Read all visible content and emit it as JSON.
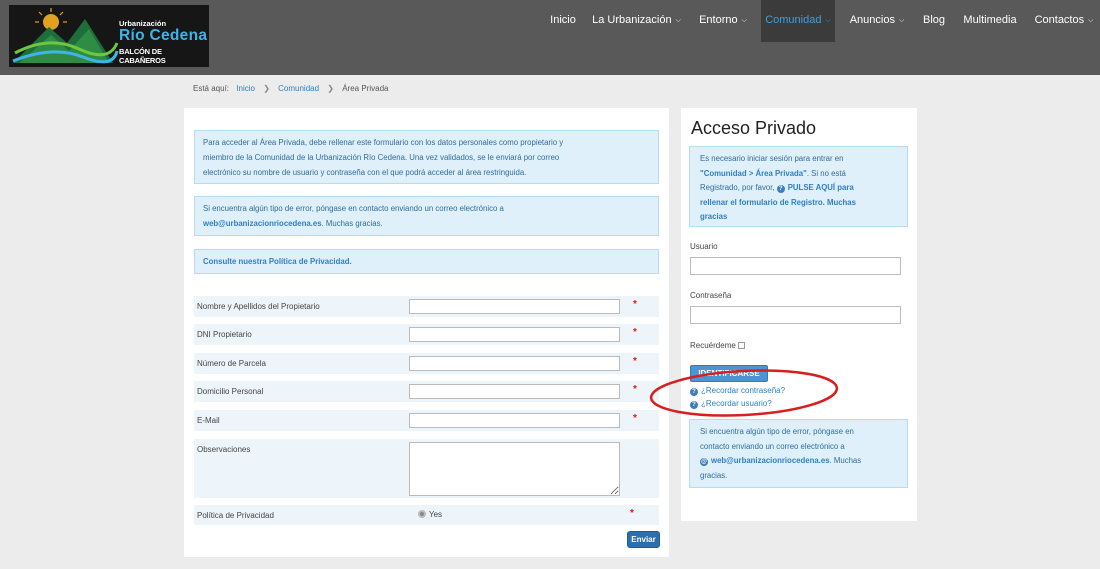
{
  "header": {
    "logo": {
      "line1": "Urbanización",
      "line2": "Río Cedena",
      "line3": "BALCÓN DE CABAÑEROS"
    },
    "nav": [
      {
        "label": "Inicio",
        "dropdown": false
      },
      {
        "label": "La Urbanización",
        "dropdown": true
      },
      {
        "label": "Entorno",
        "dropdown": true
      },
      {
        "label": "Comunidad",
        "dropdown": true,
        "active": true
      },
      {
        "label": "Anuncios",
        "dropdown": true
      },
      {
        "label": "Blog",
        "dropdown": false
      },
      {
        "label": "Multimedia",
        "dropdown": false
      },
      {
        "label": "Contactos",
        "dropdown": true
      }
    ]
  },
  "breadcrumb": {
    "prefix": "Está aquí:",
    "items": [
      "Inicio",
      "Comunidad",
      "Área Privada"
    ]
  },
  "main": {
    "note1": {
      "line1": "Para acceder al Área Privada, debe rellenar este formulario con los datos personales como propietario y",
      "line2": "miembro de la Comunidad de la Urbanización Río Cedena. Una vez validados, se le enviará por correo",
      "line3": "electrónico su nombre de usuario y contraseña con el que podrá acceder al área restringuida."
    },
    "note2": {
      "line1": "Si encuentra algún tipo de error, póngase en contacto enviando un correo electrónico a",
      "email": "web@urbanizacionriocedena.es",
      "tail": ". Muchas gracias."
    },
    "note3": "Consulte nuestra Política de Privacidad.",
    "fields": [
      {
        "label": "Nombre y Apellidos del Propietario",
        "value": "",
        "required": "*"
      },
      {
        "label": "DNI Propietario",
        "value": "",
        "required": "*"
      },
      {
        "label": "Número de Parcela",
        "value": "",
        "required": "*"
      },
      {
        "label": "Domicilio Personal",
        "value": "",
        "required": "*"
      },
      {
        "label": "E-Mail",
        "value": "",
        "required": "*"
      }
    ],
    "observaciones_label": "Observaciones",
    "privacy": {
      "label": "Política de Privacidad",
      "option": "Yes",
      "required": "*"
    },
    "submit": "Enviar"
  },
  "side": {
    "title": "Acceso Privado",
    "note1": {
      "t1": "Es necesario iniciar sesión para entrar en",
      "b1": "\"Comunidad > Área Privada\"",
      "t2": ". Si no está",
      "t3": "Registrado, por favor,",
      "b2": "PULSE AQUÍ para",
      "b3": "rellenar el formulario de Registro. Muchas",
      "b4": "gracias"
    },
    "usuario_label": "Usuario",
    "usuario_value": "",
    "password_label": "Contraseña",
    "password_value": "",
    "remember_label": "Recuérdeme",
    "login_button": "IDENTIFICARSE",
    "forgot_password": "¿Recordar contraseña?",
    "forgot_user": "¿Recordar usuario?",
    "note2": {
      "t1": "Si encuentra algún tipo de error, póngase en",
      "t2": "contacto enviando un correo electrónico a",
      "email": "web@urbanizacionriocedena.es",
      "t3": ". Muchas",
      "t4": "gracias."
    }
  },
  "colors": {
    "header_bg": "#595959",
    "accent": "#3aa0e0",
    "info_bg": "#dff0fb",
    "annotation": "#d81e1e"
  }
}
